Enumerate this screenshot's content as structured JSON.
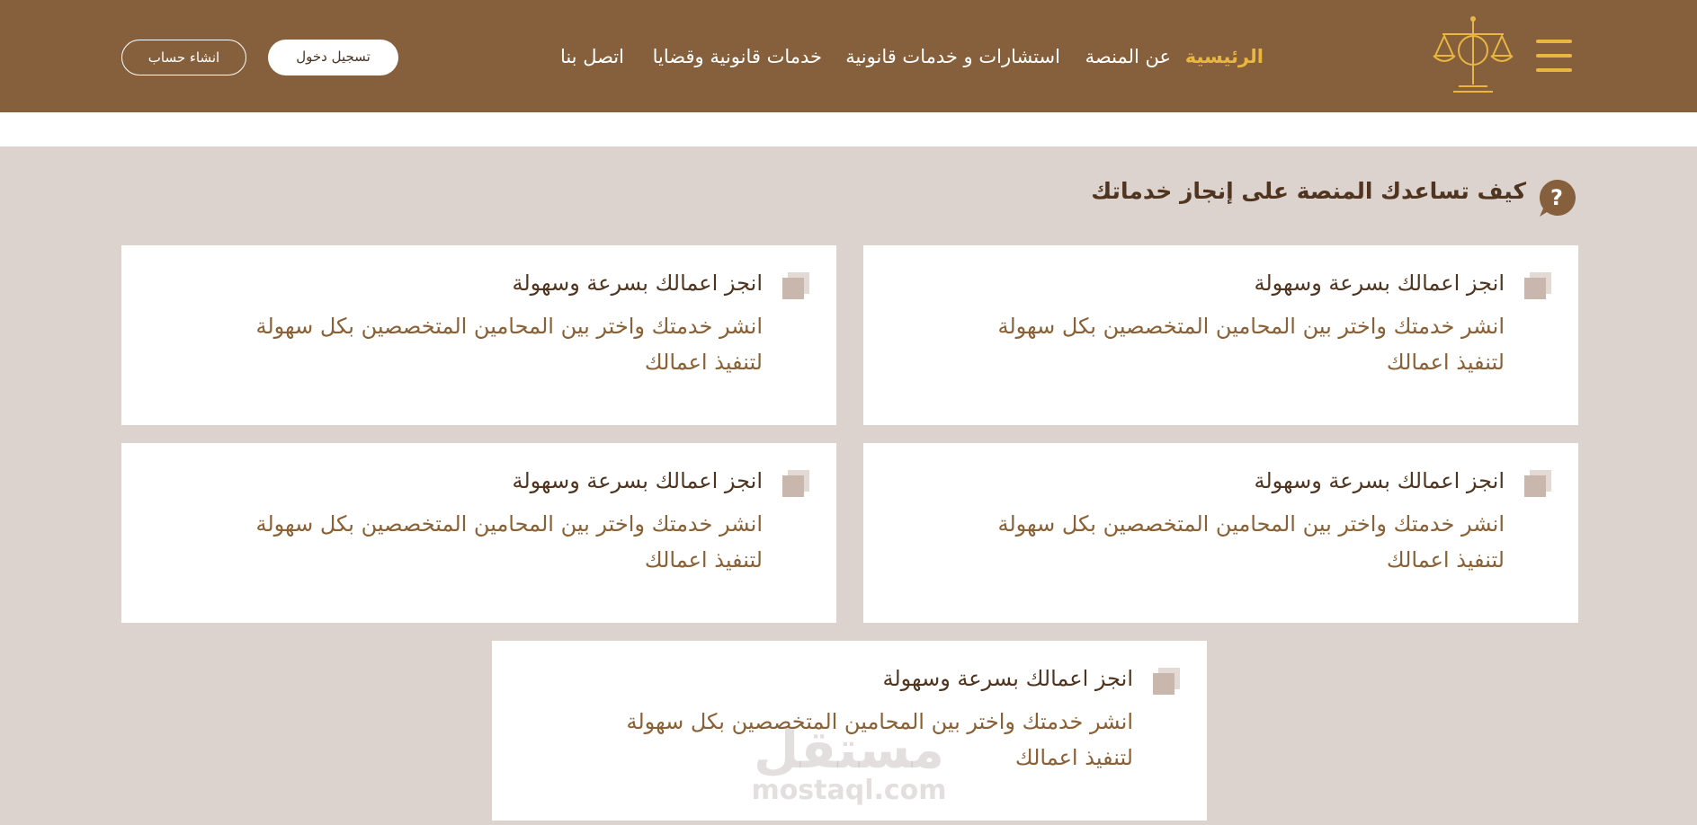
{
  "header": {
    "nav": [
      {
        "label": "الرئيسية",
        "active": true
      },
      {
        "label": "عن المنصة",
        "active": false
      },
      {
        "label": "استشارات و خدمات قانونية",
        "active": false
      },
      {
        "label": "خدمات قانونية وقضايا",
        "active": false
      },
      {
        "label": "اتصل بنا",
        "active": false
      }
    ],
    "login_label": "تسجيل دخول",
    "register_label": "انشاء حساب",
    "colors": {
      "bar": "#86603c",
      "accent": "#e8b641"
    }
  },
  "section": {
    "title": "كيف تساعدك المنصة على إنجاز خدماتك",
    "icon": "question-icon"
  },
  "cards": [
    {
      "title": "انجز اعمالك بسرعة وسهولة",
      "desc_line1": "انشر خدمتك واختر بين المحامين المتخصصين بكل سهولة",
      "desc_line2": "لتنفيذ اعمالك"
    },
    {
      "title": "انجز اعمالك بسرعة وسهولة",
      "desc_line1": "انشر خدمتك واختر بين المحامين المتخصصين بكل سهولة",
      "desc_line2": "لتنفيذ اعمالك"
    },
    {
      "title": "انجز اعمالك بسرعة وسهولة",
      "desc_line1": "انشر خدمتك واختر بين المحامين المتخصصين بكل سهولة",
      "desc_line2": "لتنفيذ اعمالك"
    },
    {
      "title": "انجز اعمالك بسرعة وسهولة",
      "desc_line1": "انشر خدمتك واختر بين المحامين المتخصصين بكل سهولة",
      "desc_line2": "لتنفيذ اعمالك"
    },
    {
      "title": "انجز اعمالك بسرعة وسهولة",
      "desc_line1": "انشر خدمتك واختر بين المحامين المتخصصين بكل سهولة",
      "desc_line2": "لتنفيذ اعمالك"
    }
  ],
  "watermark": {
    "arabic": "مستقل",
    "latin": "mostaql.com"
  }
}
